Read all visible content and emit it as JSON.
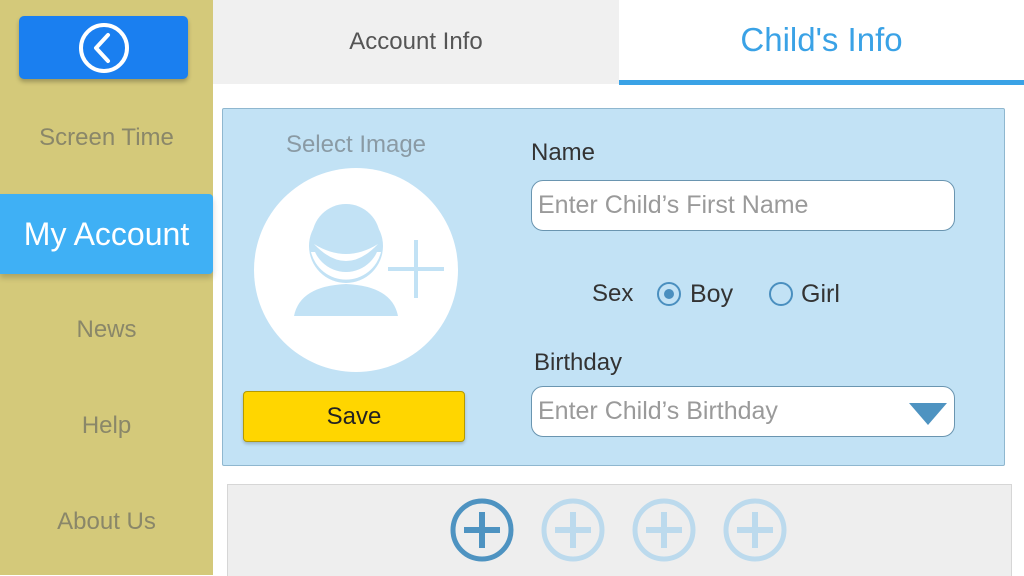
{
  "sidebar": {
    "back_icon": "chevron-left-circle-icon",
    "items": [
      {
        "label": "Screen Time"
      },
      {
        "label": "My Account"
      },
      {
        "label": "News"
      },
      {
        "label": "Help"
      },
      {
        "label": "About Us"
      }
    ],
    "active_item": "My Account"
  },
  "tabs": [
    {
      "label": "Account Info"
    },
    {
      "label": "Child's Info"
    }
  ],
  "active_tab": "Child's Info",
  "form": {
    "select_image_label": "Select Image",
    "avatar_icon": "add-user-icon",
    "save_label": "Save",
    "name_label": "Name",
    "name_placeholder": "Enter Child’s First Name",
    "name_value": "",
    "sex_label": "Sex",
    "sex_options": [
      {
        "label": "Boy",
        "selected": true
      },
      {
        "label": "Girl",
        "selected": false
      }
    ],
    "birthday_label": "Birthday",
    "birthday_placeholder": "Enter Child’s Birthday",
    "birthday_value": "",
    "birthday_caret_icon": "triangle-down-icon"
  },
  "children_slots": [
    {
      "icon": "plus-circle-icon",
      "active": true
    },
    {
      "icon": "plus-circle-icon",
      "active": false
    },
    {
      "icon": "plus-circle-icon",
      "active": false
    },
    {
      "icon": "plus-circle-icon",
      "active": false
    }
  ],
  "colors": {
    "sidebar_bg": "#d4c97a",
    "accent_blue": "#3aa2e6",
    "back_button": "#1a7ff0",
    "save_button": "#ffd600",
    "panel_bg": "#c2e2f5"
  }
}
